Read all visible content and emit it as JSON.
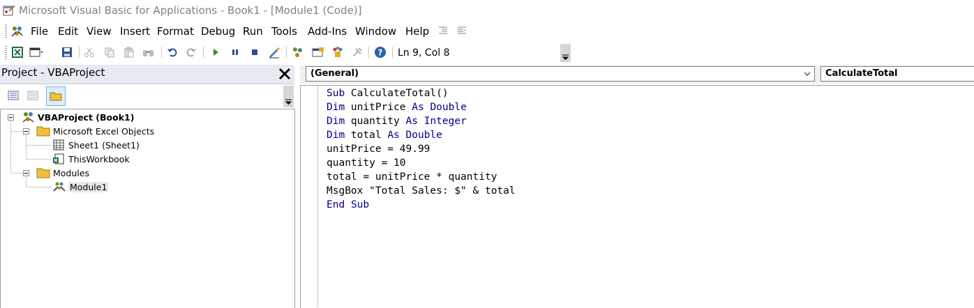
{
  "window": {
    "title": "Microsoft Visual Basic for Applications - Book1 - [Module1 (Code)]"
  },
  "menu": {
    "items": [
      {
        "label": "File"
      },
      {
        "label": "Edit"
      },
      {
        "label": "View"
      },
      {
        "label": "Insert"
      },
      {
        "label": "Format"
      },
      {
        "label": "Debug"
      },
      {
        "label": "Run"
      },
      {
        "label": "Tools"
      },
      {
        "label": "Add-Ins"
      },
      {
        "label": "Window"
      },
      {
        "label": "Help"
      }
    ]
  },
  "toolbar": {
    "cursor_position": "Ln 9, Col 8"
  },
  "project": {
    "title": "Project - VBAProject",
    "tree": {
      "root": "VBAProject (Book1)",
      "excel_objects": "Microsoft Excel Objects",
      "sheet1": "Sheet1 (Sheet1)",
      "thisworkbook": "ThisWorkbook",
      "modules": "Modules",
      "module1": "Module1"
    }
  },
  "code": {
    "object_combo": "(General)",
    "procedure_combo": "CalculateTotal",
    "lines": [
      {
        "k1": "Sub",
        "t1": " CalculateTotal()"
      },
      {
        "k1": "Dim",
        "t1": " unitPrice ",
        "k2": "As",
        "t2": " ",
        "k3": "Double"
      },
      {
        "k1": "Dim",
        "t1": " quantity ",
        "k2": "As",
        "t2": " ",
        "k3": "Integer"
      },
      {
        "k1": "Dim",
        "t1": " total ",
        "k2": "As",
        "t2": " ",
        "k3": "Double"
      },
      {
        "t1": "unitPrice = 49.99"
      },
      {
        "t1": "quantity = 10"
      },
      {
        "t1": "total = unitPrice * quantity"
      },
      {
        "t1": "MsgBox \"Total Sales: $\" & total"
      },
      {
        "k1": "End",
        "t1": " ",
        "k2": "Sub"
      }
    ]
  },
  "colors": {
    "keyword": "#00008b",
    "pane_header": "#e6ebf2"
  }
}
